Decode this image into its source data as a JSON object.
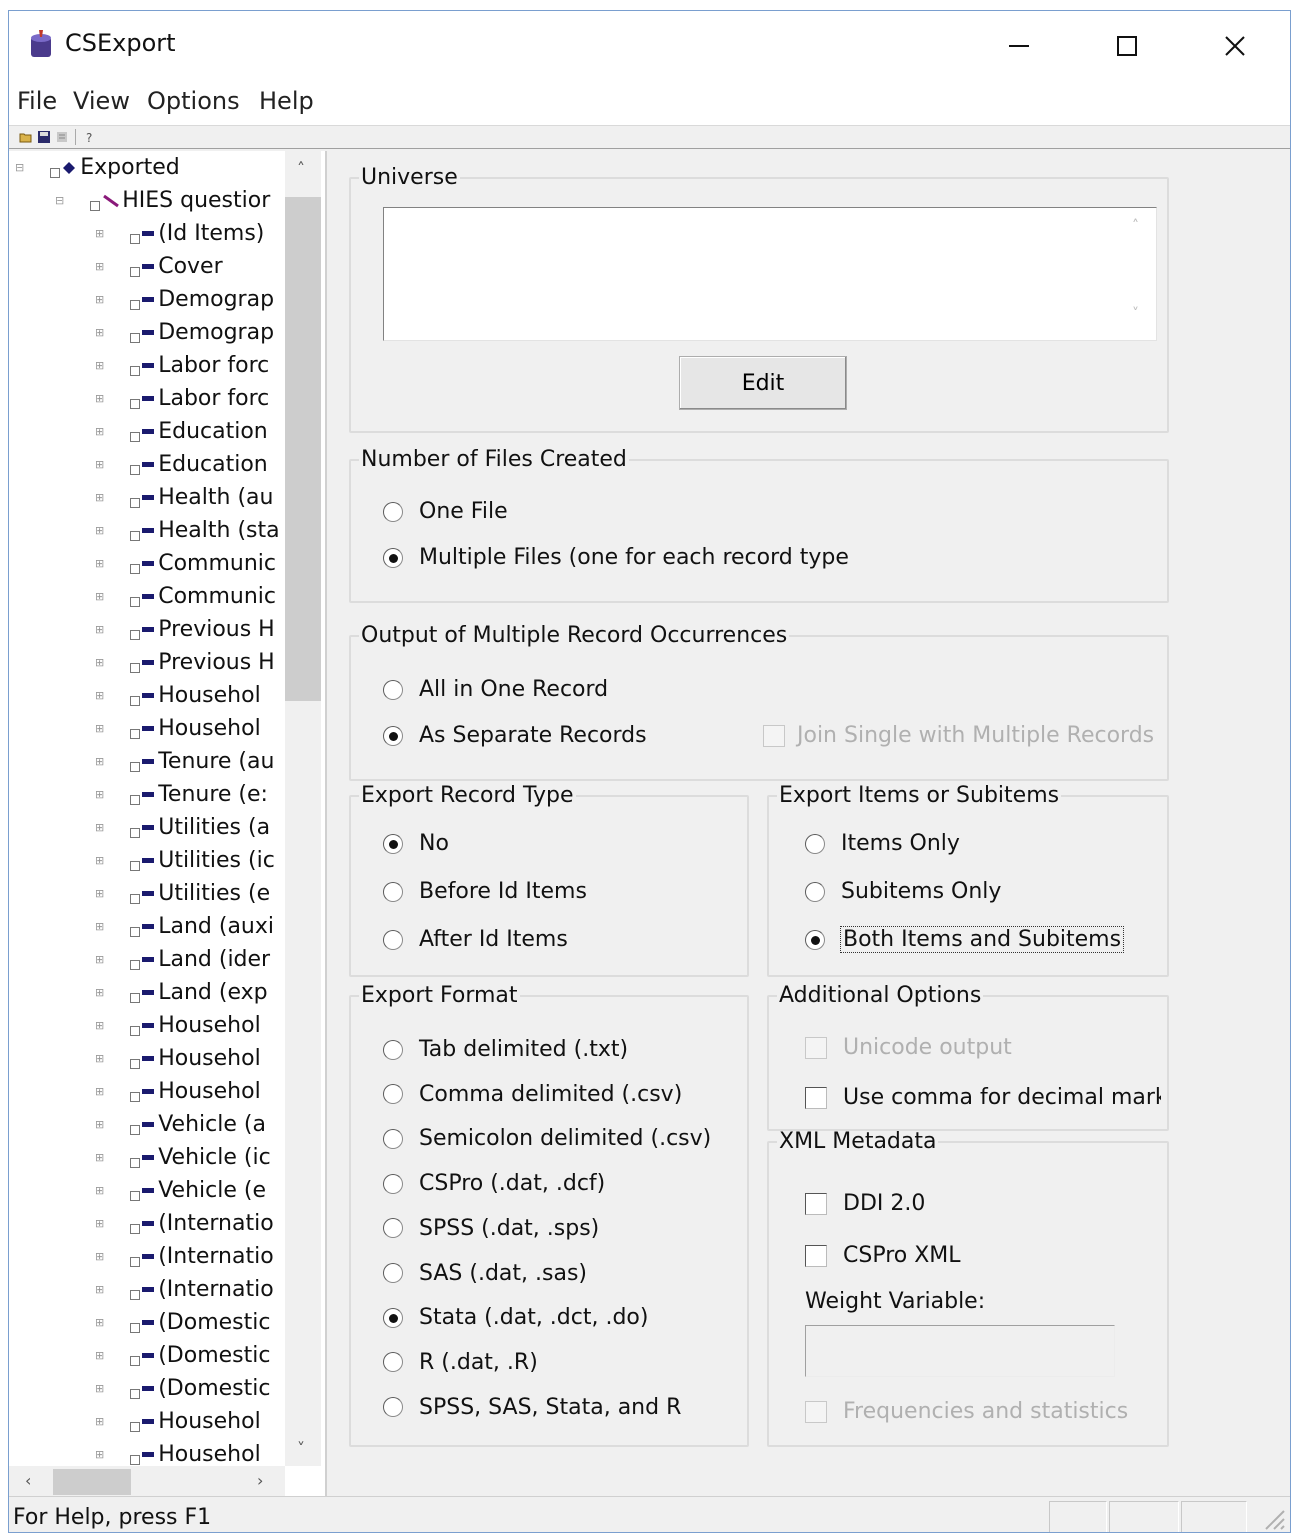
{
  "window": {
    "title": "CSExport",
    "icon": "csexport-app-icon",
    "controls": {
      "minimize": "minimize-icon",
      "maximize": "maximize-icon",
      "close": "close-icon"
    }
  },
  "menu": {
    "items": [
      "File",
      "View",
      "Options",
      "Help"
    ]
  },
  "toolbar": {
    "icons": [
      "open-folder-icon",
      "save-icon",
      "list-icon",
      "help-pointer-icon"
    ]
  },
  "tree": {
    "root": "Exported",
    "dictionary": "HIES questior",
    "items": [
      "(Id Items)",
      "Cover",
      "Demograp",
      "Demograp",
      "Labor forc",
      "Labor forc",
      "Education",
      "Education",
      "Health (au",
      "Health (sta",
      "Communic",
      "Communic",
      "Previous H",
      "Previous H",
      "Househol",
      "Househol",
      "Tenure (au",
      "Tenure (e:",
      "Utilities (a",
      "Utilities (ic",
      "Utilities (e",
      "Land (auxi",
      "Land (ider",
      "Land (exp",
      "Househol",
      "Househol",
      "Househol",
      "Vehicle (a",
      "Vehicle (ic",
      "Vehicle (e",
      "(Internatio",
      "(Internatio",
      "(Internatio",
      "(Domestic",
      "(Domestic",
      "(Domestic",
      "Househol",
      "Househol"
    ]
  },
  "universe": {
    "legend": "Universe",
    "value": "",
    "edit_label": "Edit"
  },
  "files_created": {
    "legend": "Number of Files Created",
    "options": [
      {
        "label": "One File",
        "selected": false
      },
      {
        "label": "Multiple Files (one for each record type",
        "selected": true
      }
    ]
  },
  "multiple_occurrences": {
    "legend": "Output of Multiple Record Occurrences",
    "options": [
      {
        "label": "All in One Record",
        "selected": false
      },
      {
        "label": "As Separate Records",
        "selected": true
      }
    ],
    "join_label": "Join Single with Multiple Records",
    "join_checked": false,
    "join_enabled": false
  },
  "record_type": {
    "legend": "Export Record Type",
    "options": [
      {
        "label": "No",
        "selected": true
      },
      {
        "label": "Before Id Items",
        "selected": false
      },
      {
        "label": "After Id Items",
        "selected": false
      }
    ]
  },
  "items_subitems": {
    "legend": "Export Items or Subitems",
    "options": [
      {
        "label": "Items Only",
        "selected": false
      },
      {
        "label": "Subitems Only",
        "selected": false
      },
      {
        "label": "Both Items and Subitems",
        "selected": true
      }
    ]
  },
  "export_format": {
    "legend": "Export Format",
    "options": [
      {
        "label": "Tab delimited (.txt)",
        "selected": false
      },
      {
        "label": "Comma delimited (.csv)",
        "selected": false
      },
      {
        "label": "Semicolon delimited (.csv)",
        "selected": false
      },
      {
        "label": "CSPro (.dat, .dcf)",
        "selected": false
      },
      {
        "label": "SPSS (.dat, .sps)",
        "selected": false
      },
      {
        "label": "SAS (.dat, .sas)",
        "selected": false
      },
      {
        "label": "Stata (.dat, .dct, .do)",
        "selected": true
      },
      {
        "label": "R (.dat, .R)",
        "selected": false
      },
      {
        "label": "SPSS, SAS, Stata, and R",
        "selected": false
      }
    ]
  },
  "additional_options": {
    "legend": "Additional Options",
    "unicode_label": "Unicode output",
    "unicode_checked": false,
    "unicode_enabled": false,
    "comma_label": "Use comma for decimal mark",
    "comma_checked": false
  },
  "xml_metadata": {
    "legend": "XML Metadata",
    "ddi_label": "DDI 2.0",
    "ddi_checked": false,
    "cspro_label": "CSPro XML",
    "cspro_checked": false,
    "weight_label": "Weight Variable:",
    "weight_value": "",
    "freq_label": "Frequencies and statistics",
    "freq_checked": false,
    "freq_enabled": false
  },
  "status": {
    "text": "For Help, press F1"
  }
}
